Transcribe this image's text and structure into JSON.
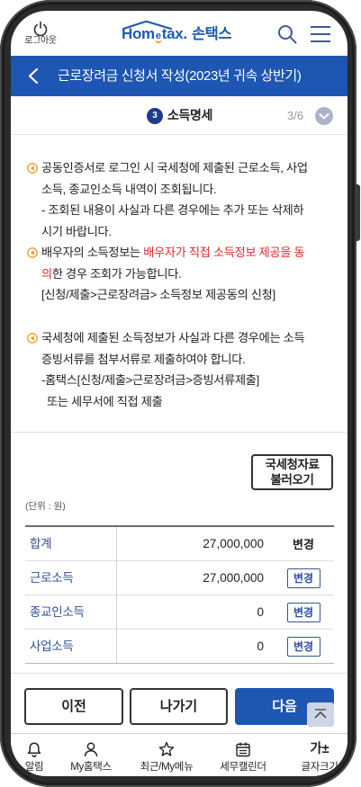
{
  "header": {
    "logout_label": "로그아웃",
    "logout_icon": "power-icon",
    "logo": {
      "part1": "Hom",
      "part2": "e",
      "part3": "tax.",
      "brand_ko": "손택스"
    },
    "search_icon": "search-icon",
    "menu_icon": "hamburger-menu-icon"
  },
  "title_bar": {
    "back_icon": "chevron-left-icon",
    "title": "근로장려금 신청서 작성(2023년 귀속 상반기)"
  },
  "step": {
    "number": "3",
    "label": "소득명세",
    "progress": "3/6",
    "toggle_icon": "chevron-down-icon"
  },
  "notices": [
    {
      "bullet_icon": "circle-arrow-left-icon",
      "lines": [
        "공동인증서로 로그인 시 국세청에 제출된 근로소득, 사업",
        "소득, 종교인소득 내역이 조회됩니다.",
        "- 조회된 내용이 사실과 다른 경우에는 추가 또는 삭제하",
        "시기 바랍니다."
      ]
    },
    {
      "bullet_icon": "circle-arrow-left-icon",
      "lines": [
        {
          "before": "배우자의 소득정보는 ",
          "highlight": "배우자가 직접 소득정보 제공을 동"
        },
        {
          "highlight": "의",
          "after": "한 경우 조회가 가능합니다."
        },
        "[신청/제출>근로장려금> 소득정보 제공동의 신청]"
      ]
    },
    {
      "bullet_icon": "circle-arrow-left-icon",
      "lines": [
        "국세청에 제출된 소득정보가 사실과 다른 경우에는 소득",
        "증빙서류를 첨부서류로 제출하여야 합니다.",
        "-홈택스[신청/제출>근로장려금>증빙서류제출]",
        "또는 세무서에 직접 제출"
      ]
    }
  ],
  "fetch_button": {
    "line1": "국세청자료",
    "line2": "불러오기"
  },
  "unit_label": "(단위 : 원)",
  "income_table": {
    "rows": [
      {
        "label": "합계",
        "amount": "27,000,000",
        "action": "변경"
      },
      {
        "label": "근로소득",
        "amount": "27,000,000",
        "action": "변경"
      },
      {
        "label": "종교인소득",
        "amount": "0",
        "action": "변경"
      },
      {
        "label": "사업소득",
        "amount": "0",
        "action": "변경"
      }
    ]
  },
  "footer_buttons": {
    "prev": "이전",
    "exit": "나가기",
    "next": "다음",
    "scroll_top_icon": "chevron-up-icon"
  },
  "bottom_nav": {
    "items": [
      {
        "label": "알림",
        "icon": "bell-icon"
      },
      {
        "label": "My홈택스",
        "icon": "person-icon"
      },
      {
        "label": "최근/My메뉴",
        "icon": "star-icon"
      },
      {
        "label": "세무캘린더",
        "icon": "calendar-icon"
      },
      {
        "label": "글자크기",
        "icon": "font-size-icon",
        "glyph": "가±"
      }
    ]
  },
  "colors": {
    "primary": "#1e56b4",
    "highlight": "#e8242a",
    "bullet": "#f39c1f",
    "step_badge": "#1d3c8c",
    "row_label": "#2f4e94"
  }
}
